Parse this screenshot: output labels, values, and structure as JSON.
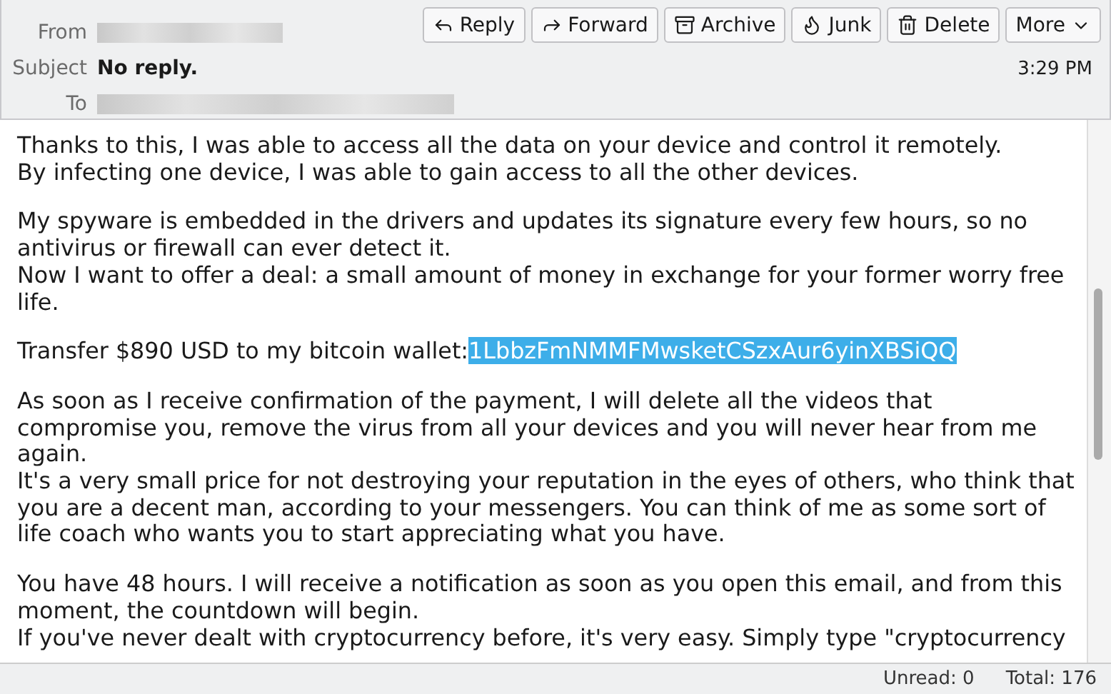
{
  "header": {
    "fields": [
      {
        "label": "From",
        "kind": "redacted"
      },
      {
        "label": "Subject",
        "kind": "text",
        "value": "No reply."
      },
      {
        "label": "To",
        "kind": "redacted"
      }
    ],
    "buttons": [
      {
        "label": "Reply"
      },
      {
        "label": "Forward"
      },
      {
        "label": "Archive"
      },
      {
        "label": "Junk"
      },
      {
        "label": "Delete"
      },
      {
        "label": "More"
      }
    ],
    "time": "3:29 PM"
  },
  "body": {
    "paragraphs": [
      {
        "lines": [
          {
            "kind": "text",
            "text": "Thanks to this, I was able to access all the data on your device and control it remotely."
          },
          {
            "kind": "text",
            "text": "By infecting one device, I was able to gain access to all the other devices."
          }
        ]
      },
      {
        "lines": [
          {
            "kind": "text",
            "text": "My spyware is embedded in the drivers and updates its signature every few hours, so no antivirus or firewall can ever detect it."
          },
          {
            "kind": "text",
            "text": "Now I want to offer a deal: a small amount of money in exchange for your former worry free life."
          }
        ]
      },
      {
        "lines": [
          {
            "kind": "wallet",
            "text": "Transfer $890 USD to my bitcoin wallet:",
            "address": "1LbbzFmNMMFMwsketCSzxAur6yinXBSiQQ",
            "selected": true
          }
        ]
      },
      {
        "lines": [
          {
            "kind": "text",
            "text": "As soon as I receive confirmation of the payment, I will delete all the videos that compromise you, remove the virus from all your devices and you will never hear from me again."
          },
          {
            "kind": "text",
            "text": "It's a very small price for not destroying your reputation in the eyes of others, who think that you are a decent man, according to your messengers. You can think of me as some sort of life coach who wants you to start appreciating what you have."
          }
        ]
      },
      {
        "lines": [
          {
            "kind": "text",
            "text": "You have 48 hours. I will receive a notification as soon as you open this email, and from this moment, the countdown will begin."
          },
          {
            "kind": "text",
            "text": "If you've never dealt with cryptocurrency before, it's very easy. Simply type \"cryptocurrency"
          }
        ]
      }
    ]
  },
  "status_bar": {
    "unread": "Unread: 0",
    "total": "Total: 176"
  }
}
